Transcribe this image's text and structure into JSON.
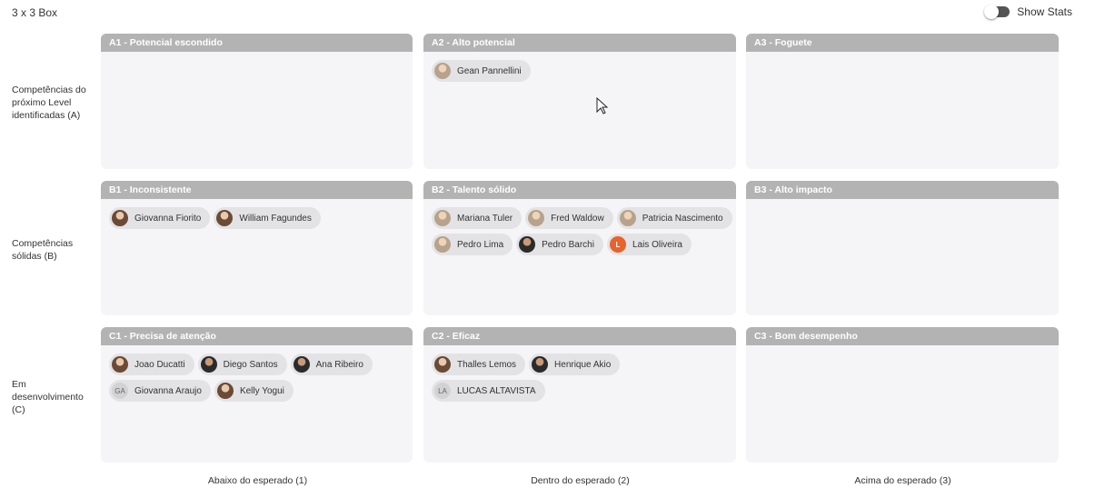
{
  "header": {
    "title": "3 x 3 Box",
    "show_stats_label": "Show Stats"
  },
  "rows": [
    {
      "label": "Competências do próximo Level identificadas (A)"
    },
    {
      "label": "Competências sólidas (B)"
    },
    {
      "label": "Em desenvolvimento (C)"
    }
  ],
  "columns": [
    {
      "label": "Abaixo do esperado (1)"
    },
    {
      "label": "Dentro do esperado (2)"
    },
    {
      "label": "Acima do esperado (3)"
    }
  ],
  "boxes": {
    "A1": {
      "title": "A1 - Potencial escondido",
      "people": []
    },
    "A2": {
      "title": "A2 - Alto potencial",
      "people": [
        {
          "name": "Gean Pannellini",
          "avatar": "photo-light"
        }
      ]
    },
    "A3": {
      "title": "A3 - Foguete",
      "people": []
    },
    "B1": {
      "title": "B1 - Inconsistente",
      "people": [
        {
          "name": "Giovanna Fiorito",
          "avatar": "photo"
        },
        {
          "name": "William Fagundes",
          "avatar": "photo"
        }
      ]
    },
    "B2": {
      "title": "B2 - Talento sólido",
      "people": [
        {
          "name": "Mariana Tuler",
          "avatar": "photo-light"
        },
        {
          "name": "Fred Waldow",
          "avatar": "photo-light"
        },
        {
          "name": "Patricia Nascimento",
          "avatar": "photo-light"
        },
        {
          "name": "Pedro Lima",
          "avatar": "photo-light"
        },
        {
          "name": "Pedro Barchi",
          "avatar": "photo-dark"
        },
        {
          "name": "Lais Oliveira",
          "avatar": "initials-orange",
          "initials": "L"
        }
      ]
    },
    "B3": {
      "title": "B3 - Alto impacto",
      "people": []
    },
    "C1": {
      "title": "C1 - Precisa de atenção",
      "people": [
        {
          "name": "Joao Ducatti",
          "avatar": "photo"
        },
        {
          "name": "Diego Santos",
          "avatar": "photo-dark"
        },
        {
          "name": "Ana Ribeiro",
          "avatar": "photo-dark"
        },
        {
          "name": "Giovanna Araujo",
          "avatar": "initials",
          "initials": "GA"
        },
        {
          "name": "Kelly Yogui",
          "avatar": "photo"
        }
      ]
    },
    "C2": {
      "title": "C2 - Eficaz",
      "people": [
        {
          "name": "Thalles Lemos",
          "avatar": "photo"
        },
        {
          "name": "Henrique Akio",
          "avatar": "photo-dark"
        },
        {
          "name": "LUCAS ALTAVISTA",
          "avatar": "initials",
          "initials": "LA"
        }
      ]
    },
    "C3": {
      "title": "C3 - Bom desempenho",
      "people": []
    }
  }
}
